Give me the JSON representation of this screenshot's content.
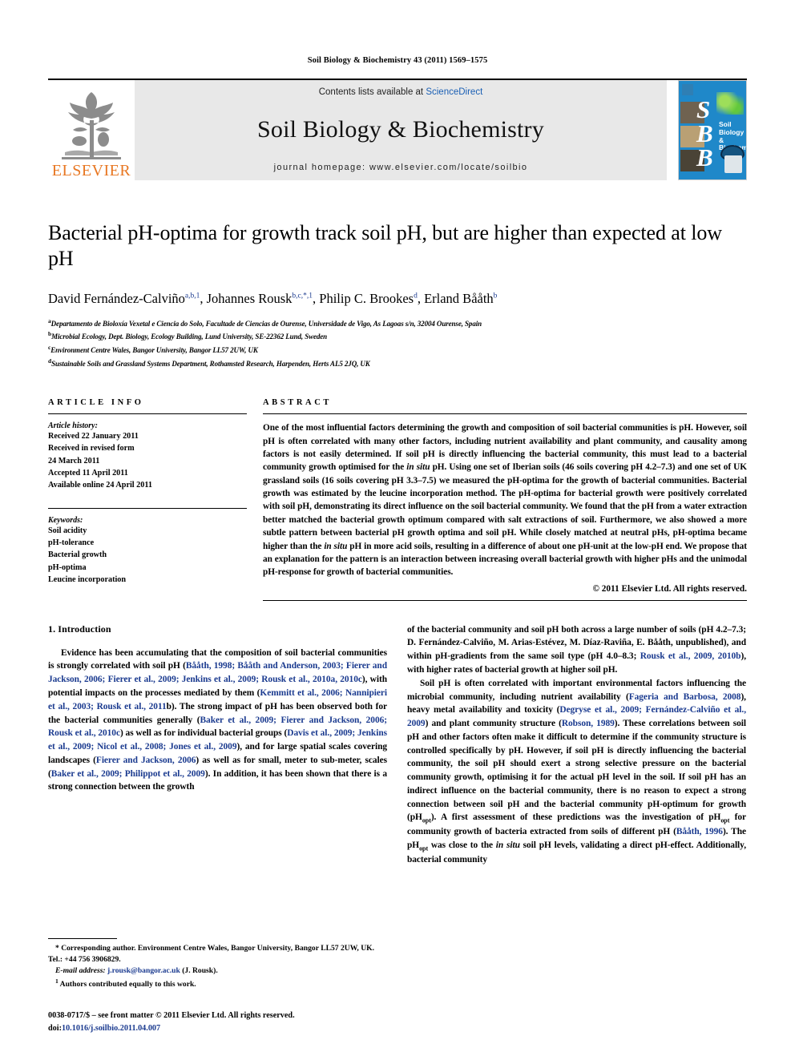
{
  "running_head": "Soil Biology & Biochemistry 43 (2011) 1569–1575",
  "masthead": {
    "publisher_name": "ELSEVIER",
    "contents_prefix": "Contents lists available at ",
    "contents_link": "ScienceDirect",
    "journal_title": "Soil Biology & Biochemistry",
    "homepage": "journal homepage: www.elsevier.com/locate/soilbio",
    "cover": {
      "letters": [
        "S",
        "B",
        "B"
      ],
      "title_line1": "Soil Biology &",
      "title_line2": "Biochemistry"
    }
  },
  "article": {
    "title": "Bacterial pH-optima for growth track soil pH, but are higher than expected at low pH",
    "authors_html": "David Fernández-Calviño<sup>a,b,1</sup>, Johannes Rousk<sup>b,c,*,1</sup>, Philip C. Brookes<sup>d</sup>, Erland Bååth<sup>b</sup>",
    "affiliations": [
      {
        "marker": "a",
        "text": "Departamento de Bioloxía Vexetal e Ciencia do Solo, Facultade de Ciencias de Ourense, Universidade de Vigo, As Lagoas s/n, 32004 Ourense, Spain"
      },
      {
        "marker": "b",
        "text": "Microbial Ecology, Dept. Biology, Ecology Building, Lund University, SE-22362 Lund, Sweden"
      },
      {
        "marker": "c",
        "text": "Environment Centre Wales, Bangor University, Bangor LL57 2UW, UK"
      },
      {
        "marker": "d",
        "text": "Sustainable Soils and Grassland Systems Department, Rothamsted Research, Harpenden, Herts AL5 2JQ, UK"
      }
    ]
  },
  "article_info": {
    "heading": "ARTICLE INFO",
    "history_label": "Article history:",
    "history": [
      "Received 22 January 2011",
      "Received in revised form",
      "24 March 2011",
      "Accepted 11 April 2011",
      "Available online 24 April 2011"
    ],
    "keywords_label": "Keywords:",
    "keywords": [
      "Soil acidity",
      "pH-tolerance",
      "Bacterial growth",
      "pH-optima",
      "Leucine incorporation"
    ]
  },
  "abstract": {
    "heading": "ABSTRACT",
    "text_html": "One of the most influential factors determining the growth and composition of soil bacterial communities is pH. However, soil pH is often correlated with many other factors, including nutrient availability and plant community, and causality among factors is not easily determined. If soil pH is directly influencing the bacterial community, this must lead to a bacterial community growth optimised for the <i>in situ</i> pH. Using one set of Iberian soils (46 soils covering pH 4.2–7.3) and one set of UK grassland soils (16 soils covering pH 3.3–7.5) we measured the pH-optima for the growth of bacterial communities. Bacterial growth was estimated by the leucine incorporation method. The pH-optima for bacterial growth were positively correlated with soil pH, demonstrating its direct influence on the soil bacterial community. We found that the pH from a water extraction better matched the bacterial growth optimum compared with salt extractions of soil. Furthermore, we also showed a more subtle pattern between bacterial pH growth optima and soil pH. While closely matched at neutral pHs, pH-optima became higher than the <i>in situ</i> pH in more acid soils, resulting in a difference of about one pH-unit at the low-pH end. We propose that an explanation for the pattern is an interaction between increasing overall bacterial growth with higher pHs and the unimodal pH-response for growth of bacterial communities.",
    "copyright": "© 2011 Elsevier Ltd. All rights reserved."
  },
  "introduction": {
    "heading": "1. Introduction",
    "left_paragraphs_html": [
      "Evidence has been accumulating that the composition of soil bacterial communities is strongly correlated with soil pH (<span class=\"ref\">Bååth, 1998; Bååth and Anderson, 2003; Fierer and Jackson, 2006; Fierer et al., 2009; Jenkins et al., 2009; Rousk et al., 2010a, 2010c</span>), with potential impacts on the processes mediated by them (<span class=\"ref\">Kemmitt et al., 2006; Nannipieri et al., 2003; Rousk et al., 2011</span>b). The strong impact of pH has been observed both for the bacterial communities generally (<span class=\"ref\">Baker et al., 2009; Fierer and Jackson, 2006; Rousk et al., 2010c</span>) as well as for individual bacterial groups (<span class=\"ref\">Davis et al., 2009; Jenkins et al., 2009; Nicol et al., 2008; Jones et al., 2009</span>), and for large spatial scales covering landscapes (<span class=\"ref\">Fierer and Jackson, 2006</span>) as well as for small, meter to sub-meter, scales (<span class=\"ref\">Baker et al., 2009; Philippot et al., 2009</span>). In addition, it has been shown that there is a strong connection between the growth"
    ],
    "right_paragraphs_html": [
      "of the bacterial community and soil pH both across a large number of soils (pH 4.2–7.3; D. Fernández-Calviño, M. Arias-Estévez, M. Díaz-Raviña, E. Bååth, unpublished), and within pH-gradients from the same soil type (pH 4.0–8.3; <span class=\"ref\">Rousk et al., 2009, 2010b</span>), with higher rates of bacterial growth at higher soil pH.",
      "Soil pH is often correlated with important environmental factors influencing the microbial community, including nutrient availability (<span class=\"ref\">Fageria and Barbosa, 2008</span>), heavy metal availability and toxicity (<span class=\"ref\">Degryse et al., 2009; Fernández-Calviño et al., 2009</span>) and plant community structure (<span class=\"ref\">Robson, 1989</span>). These correlations between soil pH and other factors often make it difficult to determine if the community structure is controlled specifically by pH. However, if soil pH is directly influencing the bacterial community, the soil pH should exert a strong selective pressure on the bacterial community growth, optimising it for the actual pH level in the soil. If soil pH has an indirect influence on the bacterial community, there is no reason to expect a strong connection between soil pH and the bacterial community pH-optimum for growth (pH<sub>opt</sub>). A first assessment of these predictions was the investigation of pH<sub>opt</sub> for community growth of bacteria extracted from soils of different pH (<span class=\"ref\">Bååth, 1996</span>). The pH<sub>opt</sub> was close to the <i>in situ</i> soil pH levels, validating a direct pH-effect. Additionally, bacterial community"
    ]
  },
  "footnotes": {
    "corresponding_html": "* Corresponding author. Environment Centre Wales, Bangor University, Bangor LL57 2UW, UK. Tel.: +44 756 3906829.",
    "email_html": "<i>E-mail address:</i> <span class=\"mail\">j.rousk@bangor.ac.uk</span> (J. Rousk).",
    "equal_contrib_html": "<sup>1</sup> Authors contributed equally to this work."
  },
  "page_footer": {
    "front_matter": "0038-0717/$ – see front matter © 2011 Elsevier Ltd. All rights reserved.",
    "doi_label": "doi:",
    "doi_value": "10.1016/j.soilbio.2011.04.007"
  },
  "colors": {
    "link": "#1a5fb4",
    "reference": "#1a3a8f",
    "elsevier_orange": "#E87722",
    "band_grey": "#e8e8e8",
    "cover_blue": "#1f88c9"
  }
}
